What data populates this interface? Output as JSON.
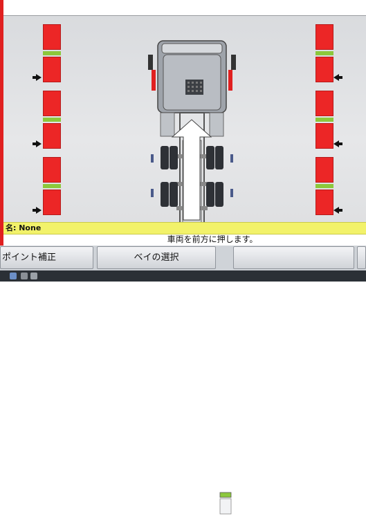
{
  "status": {
    "vehicle_name_line": "名: None",
    "message": "車両を前方に押します。"
  },
  "buttons": {
    "point_correction": "ポイント補正",
    "bay_select": "ベイの選択"
  },
  "icons": {
    "taskbar": [
      "start-icon",
      "folder-icon",
      "app-icon"
    ]
  },
  "colors": {
    "sensor_red": "#ec2626",
    "level_green": "#8cc83c",
    "status_yellow": "#f2f26a",
    "guidance_arrow": "#ffffff"
  }
}
